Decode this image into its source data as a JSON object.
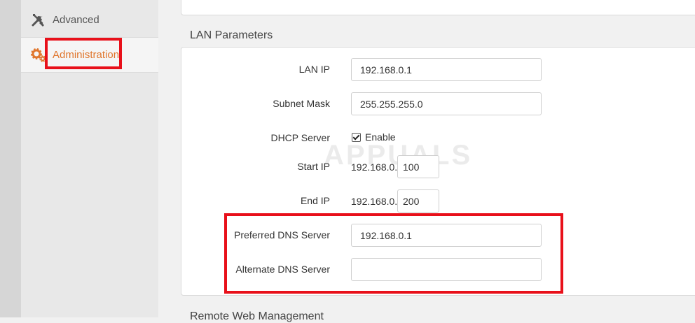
{
  "sidebar": {
    "items": [
      {
        "label": "Advanced",
        "icon": "tools-icon"
      },
      {
        "label": "Administration",
        "icon": "gears-icon",
        "active": true
      }
    ]
  },
  "lan": {
    "title": "LAN Parameters",
    "lan_ip_label": "LAN IP",
    "lan_ip_value": "192.168.0.1",
    "subnet_label": "Subnet Mask",
    "subnet_value": "255.255.255.0",
    "dhcp_label": "DHCP Server",
    "dhcp_enable_label": "Enable",
    "dhcp_enabled": true,
    "start_ip_label": "Start IP",
    "start_ip_prefix": "192.168.0.",
    "start_ip_value": "100",
    "end_ip_label": "End IP",
    "end_ip_prefix": "192.168.0.",
    "end_ip_value": "200",
    "preferred_dns_label": "Preferred DNS Server",
    "preferred_dns_value": "192.168.0.1",
    "alternate_dns_label": "Alternate DNS Server",
    "alternate_dns_value": ""
  },
  "next_section_title": "Remote Web Management",
  "watermark": "APPUALS",
  "colors": {
    "accent": "#e0762d",
    "highlight_box": "#e8101a"
  }
}
